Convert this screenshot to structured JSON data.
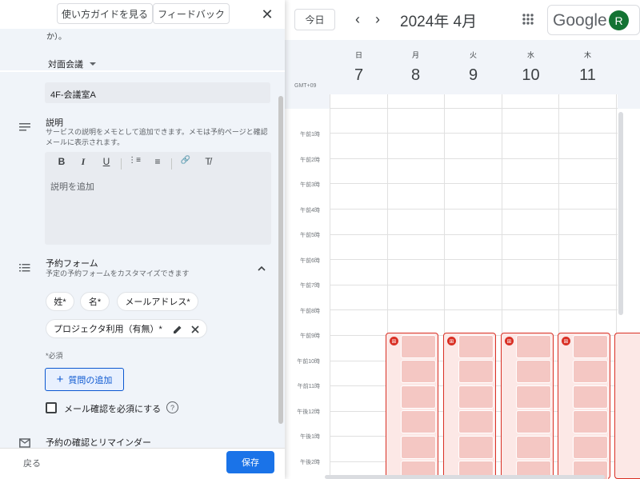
{
  "panel": {
    "guide_button": "使い方ガイドを見る",
    "feedback_button": "フィードバック",
    "close_symbol": "✕",
    "text_fragment": "か）。",
    "meeting_type": "対面会議",
    "location": "4F-会議室A",
    "description": {
      "title": "説明",
      "subtitle": "サービスの説明をメモとして追加できます。メモは予約ページと確認メールに表示されます。",
      "placeholder": "説明を追加",
      "toolbar": [
        "B",
        "I",
        "U",
        "⋮≡",
        "≡",
        "🔗",
        "T̸"
      ]
    },
    "booking_form": {
      "title": "予約フォーム",
      "subtitle": "予定の予約フォームをカスタマイズできます",
      "chips": [
        "姓*",
        "名*",
        "メールアドレス*",
        "プロジェクタ利用（有無）*"
      ],
      "required_note": "*必須",
      "add_question": "質問の追加",
      "add_symbol": "+",
      "email_verify": "メール確認を必須にする",
      "help_symbol": "?"
    },
    "next_section": "予約の確認とリマインダー",
    "back": "戻る",
    "save": "保存"
  },
  "calendar": {
    "today": "今日",
    "prev": "‹",
    "next": "›",
    "month": "2024年 4月",
    "brand": "Google",
    "avatar_initial": "R",
    "timezone": "GMT+09",
    "days": [
      {
        "name": "日",
        "num": "7"
      },
      {
        "name": "月",
        "num": "8"
      },
      {
        "name": "火",
        "num": "9"
      },
      {
        "name": "水",
        "num": "10"
      },
      {
        "name": "木",
        "num": "11"
      }
    ],
    "hours": [
      "午前1時",
      "午前2時",
      "午前3時",
      "午前4時",
      "午前5時",
      "午前6時",
      "午前7時",
      "午前8時",
      "午前9時",
      "午前10時",
      "午前11時",
      "午後12時",
      "午後1時",
      "午後2時"
    ]
  },
  "colors": {
    "primary": "#1a73e8",
    "booking_border": "#d93025",
    "booking_fill": "#fce8e6"
  }
}
